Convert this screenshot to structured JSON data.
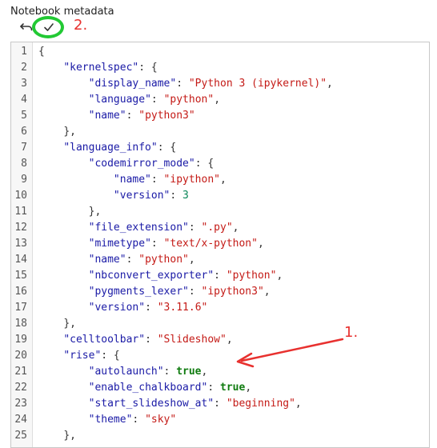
{
  "panel": {
    "title": "Notebook metadata"
  },
  "toolbar": {
    "undo_icon": "undo-icon",
    "apply_icon": "checkmark-icon"
  },
  "annotations": {
    "label_1": "1.",
    "label_2": "2.",
    "arrow_color": "#e8312f",
    "circle_color": "#22c934"
  },
  "editor": {
    "lines": [
      {
        "num": "1",
        "tokens": [
          {
            "t": "{",
            "c": "punct"
          }
        ]
      },
      {
        "num": "2",
        "tokens": [
          {
            "t": "    ",
            "c": "ws"
          },
          {
            "t": "\"kernelspec\"",
            "c": "key"
          },
          {
            "t": ": {",
            "c": "punct"
          }
        ]
      },
      {
        "num": "3",
        "tokens": [
          {
            "t": "        ",
            "c": "ws"
          },
          {
            "t": "\"display_name\"",
            "c": "key"
          },
          {
            "t": ": ",
            "c": "punct"
          },
          {
            "t": "\"Python 3 (ipykernel)\"",
            "c": "str"
          },
          {
            "t": ",",
            "c": "punct"
          }
        ]
      },
      {
        "num": "4",
        "tokens": [
          {
            "t": "        ",
            "c": "ws"
          },
          {
            "t": "\"language\"",
            "c": "key"
          },
          {
            "t": ": ",
            "c": "punct"
          },
          {
            "t": "\"python\"",
            "c": "str"
          },
          {
            "t": ",",
            "c": "punct"
          }
        ]
      },
      {
        "num": "5",
        "tokens": [
          {
            "t": "        ",
            "c": "ws"
          },
          {
            "t": "\"name\"",
            "c": "key"
          },
          {
            "t": ": ",
            "c": "punct"
          },
          {
            "t": "\"python3\"",
            "c": "str"
          }
        ]
      },
      {
        "num": "6",
        "tokens": [
          {
            "t": "    ",
            "c": "ws"
          },
          {
            "t": "},",
            "c": "punct"
          }
        ]
      },
      {
        "num": "7",
        "tokens": [
          {
            "t": "    ",
            "c": "ws"
          },
          {
            "t": "\"language_info\"",
            "c": "key"
          },
          {
            "t": ": {",
            "c": "punct"
          }
        ]
      },
      {
        "num": "8",
        "tokens": [
          {
            "t": "        ",
            "c": "ws"
          },
          {
            "t": "\"codemirror_mode\"",
            "c": "key"
          },
          {
            "t": ": {",
            "c": "punct"
          }
        ]
      },
      {
        "num": "9",
        "tokens": [
          {
            "t": "            ",
            "c": "ws"
          },
          {
            "t": "\"name\"",
            "c": "key"
          },
          {
            "t": ": ",
            "c": "punct"
          },
          {
            "t": "\"ipython\"",
            "c": "str"
          },
          {
            "t": ",",
            "c": "punct"
          }
        ]
      },
      {
        "num": "10",
        "tokens": [
          {
            "t": "            ",
            "c": "ws"
          },
          {
            "t": "\"version\"",
            "c": "key"
          },
          {
            "t": ": ",
            "c": "punct"
          },
          {
            "t": "3",
            "c": "num"
          }
        ]
      },
      {
        "num": "11",
        "tokens": [
          {
            "t": "        ",
            "c": "ws"
          },
          {
            "t": "},",
            "c": "punct"
          }
        ]
      },
      {
        "num": "12",
        "tokens": [
          {
            "t": "        ",
            "c": "ws"
          },
          {
            "t": "\"file_extension\"",
            "c": "key"
          },
          {
            "t": ": ",
            "c": "punct"
          },
          {
            "t": "\".py\"",
            "c": "str"
          },
          {
            "t": ",",
            "c": "punct"
          }
        ]
      },
      {
        "num": "13",
        "tokens": [
          {
            "t": "        ",
            "c": "ws"
          },
          {
            "t": "\"mimetype\"",
            "c": "key"
          },
          {
            "t": ": ",
            "c": "punct"
          },
          {
            "t": "\"text/x-python\"",
            "c": "str"
          },
          {
            "t": ",",
            "c": "punct"
          }
        ]
      },
      {
        "num": "14",
        "tokens": [
          {
            "t": "        ",
            "c": "ws"
          },
          {
            "t": "\"name\"",
            "c": "key"
          },
          {
            "t": ": ",
            "c": "punct"
          },
          {
            "t": "\"python\"",
            "c": "str"
          },
          {
            "t": ",",
            "c": "punct"
          }
        ]
      },
      {
        "num": "15",
        "tokens": [
          {
            "t": "        ",
            "c": "ws"
          },
          {
            "t": "\"nbconvert_exporter\"",
            "c": "key"
          },
          {
            "t": ": ",
            "c": "punct"
          },
          {
            "t": "\"python\"",
            "c": "str"
          },
          {
            "t": ",",
            "c": "punct"
          }
        ]
      },
      {
        "num": "16",
        "tokens": [
          {
            "t": "        ",
            "c": "ws"
          },
          {
            "t": "\"pygments_lexer\"",
            "c": "key"
          },
          {
            "t": ": ",
            "c": "punct"
          },
          {
            "t": "\"ipython3\"",
            "c": "str"
          },
          {
            "t": ",",
            "c": "punct"
          }
        ]
      },
      {
        "num": "17",
        "tokens": [
          {
            "t": "        ",
            "c": "ws"
          },
          {
            "t": "\"version\"",
            "c": "key"
          },
          {
            "t": ": ",
            "c": "punct"
          },
          {
            "t": "\"3.11.6\"",
            "c": "str"
          }
        ]
      },
      {
        "num": "18",
        "tokens": [
          {
            "t": "    ",
            "c": "ws"
          },
          {
            "t": "},",
            "c": "punct"
          }
        ]
      },
      {
        "num": "19",
        "tokens": [
          {
            "t": "    ",
            "c": "ws"
          },
          {
            "t": "\"celltoolbar\"",
            "c": "key"
          },
          {
            "t": ": ",
            "c": "punct"
          },
          {
            "t": "\"Slideshow\"",
            "c": "str"
          },
          {
            "t": ",",
            "c": "punct"
          }
        ]
      },
      {
        "num": "20",
        "tokens": [
          {
            "t": "    ",
            "c": "ws"
          },
          {
            "t": "\"rise\"",
            "c": "key"
          },
          {
            "t": ": {",
            "c": "punct"
          }
        ]
      },
      {
        "num": "21",
        "tokens": [
          {
            "t": "        ",
            "c": "ws"
          },
          {
            "t": "\"autolaunch\"",
            "c": "key"
          },
          {
            "t": ": ",
            "c": "punct"
          },
          {
            "t": "true",
            "c": "bool"
          },
          {
            "t": ",",
            "c": "punct"
          }
        ]
      },
      {
        "num": "22",
        "tokens": [
          {
            "t": "        ",
            "c": "ws"
          },
          {
            "t": "\"enable_chalkboard\"",
            "c": "key"
          },
          {
            "t": ": ",
            "c": "punct"
          },
          {
            "t": "true",
            "c": "bool"
          },
          {
            "t": ",",
            "c": "punct"
          }
        ]
      },
      {
        "num": "23",
        "tokens": [
          {
            "t": "        ",
            "c": "ws"
          },
          {
            "t": "\"start_slideshow_at\"",
            "c": "key"
          },
          {
            "t": ": ",
            "c": "punct"
          },
          {
            "t": "\"beginning\"",
            "c": "str"
          },
          {
            "t": ",",
            "c": "punct"
          }
        ]
      },
      {
        "num": "24",
        "tokens": [
          {
            "t": "        ",
            "c": "ws"
          },
          {
            "t": "\"theme\"",
            "c": "key"
          },
          {
            "t": ": ",
            "c": "punct"
          },
          {
            "t": "\"sky\"",
            "c": "str"
          }
        ]
      },
      {
        "num": "25",
        "tokens": [
          {
            "t": "    ",
            "c": "ws"
          },
          {
            "t": "},",
            "c": "punct"
          }
        ]
      }
    ]
  }
}
